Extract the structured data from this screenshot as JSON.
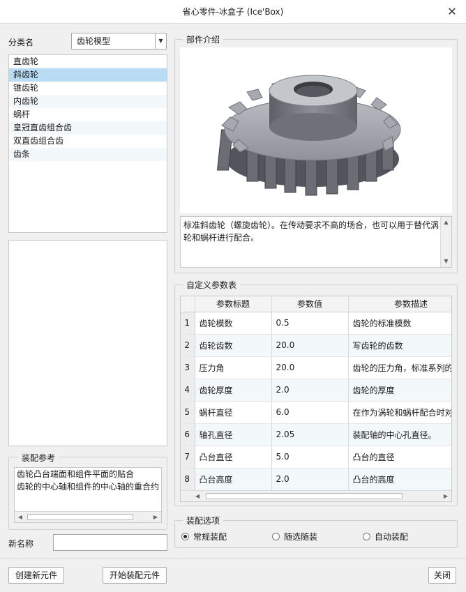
{
  "window": {
    "title": "省心零件-冰盒子 (Ice'Box)"
  },
  "left": {
    "category_label": "分类名",
    "category_selected": "齿轮模型",
    "parts": [
      "直齿轮",
      "斜齿轮",
      "锥齿轮",
      "内齿轮",
      "蜗杆",
      "皇冠直齿组合齿",
      "双直齿组合齿",
      "齿条"
    ],
    "selected_part": "斜齿轮",
    "assembly_ref_title": "装配参考",
    "assembly_ref_lines": [
      "齿轮凸台端面和组件平面的贴合",
      "齿轮的中心轴和组件的中心轴的重合约"
    ],
    "new_name_label": "新名称",
    "new_name_value": ""
  },
  "intro": {
    "title": "部件介绍",
    "description": "标准斜齿轮（螺旋齿轮）。在传动要求不高的场合，也可以用于替代涡轮和蜗杆进行配合。"
  },
  "params": {
    "title": "自定义参数表",
    "columns": [
      "参数标题",
      "参数值",
      "参数描述"
    ],
    "rows": [
      {
        "n": "1",
        "title": "齿轮模数",
        "value": "0.5",
        "desc": "齿轮的标准模数"
      },
      {
        "n": "2",
        "title": "齿轮齿数",
        "value": "20.0",
        "desc": "写齿轮的齿数"
      },
      {
        "n": "3",
        "title": "压力角",
        "value": "20.0",
        "desc": "齿轮的压力角，标准系列的"
      },
      {
        "n": "4",
        "title": "齿轮厚度",
        "value": "2.0",
        "desc": "齿轮的厚度"
      },
      {
        "n": "5",
        "title": "蜗杆直径",
        "value": "6.0",
        "desc": "在作为涡轮和蜗杆配合时对"
      },
      {
        "n": "6",
        "title": "轴孔直径",
        "value": "2.05",
        "desc": "装配轴的中心孔直径。"
      },
      {
        "n": "7",
        "title": "凸台直径",
        "value": "5.0",
        "desc": "凸台的直径"
      },
      {
        "n": "8",
        "title": "凸台高度",
        "value": "2.0",
        "desc": "凸台的高度"
      }
    ]
  },
  "options": {
    "title": "装配选项",
    "items": [
      "常规装配",
      "随选随装",
      "自动装配"
    ],
    "selected": "常规装配"
  },
  "buttons": {
    "create": "创建新元件",
    "assemble": "开始装配元件",
    "close": "关闭"
  },
  "icons": {
    "close": "close-icon",
    "dropdown": "chevron-down-icon"
  }
}
